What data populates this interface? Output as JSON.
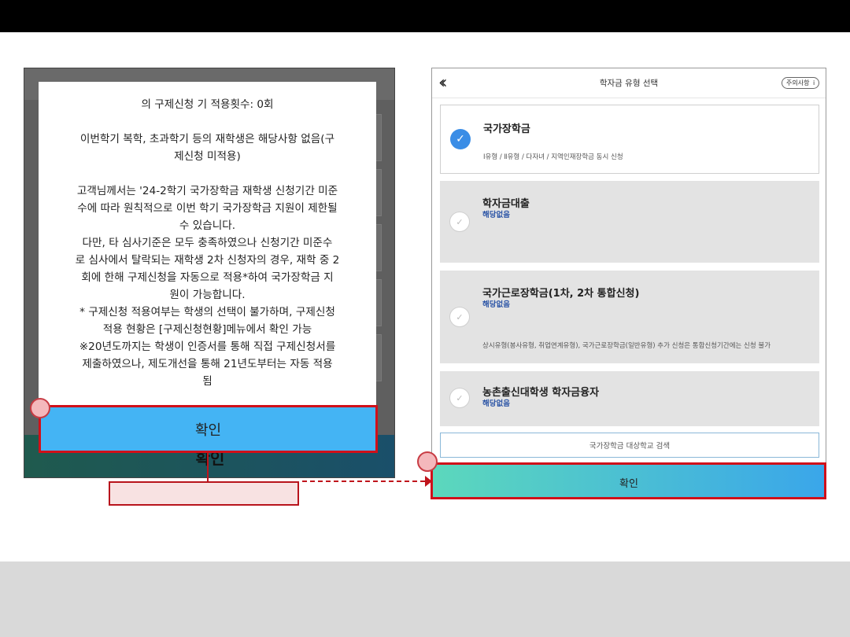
{
  "left_screen": {
    "background_confirm_label": "확인",
    "modal": {
      "lines": [
        "의 구제신청 기 적용횟수: 0회",
        "",
        "이번학기 복학, 초과학기 등의 재학생은 해당사항 없음(구",
        "제신청 미적용)",
        "",
        "고객님께서는 '24-2학기 국가장학금 재학생 신청기간 미준",
        "수에 따라 원칙적으로 이번 학기 국가장학금 지원이 제한될",
        "수 있습니다.",
        "다만, 타 심사기준은 모두 충족하였으나 신청기간 미준수",
        "로 심사에서 탈락되는 재학생 2차 신청자의 경우, 재학 중 2",
        "회에 한해 구제신청을 자동으로 적용*하여 국가장학금 지",
        "원이 가능합니다.",
        "* 구제신청 적용여부는 학생의 선택이 불가하며, 구제신청",
        "적용 현황은 [구제신청현황]메뉴에서 확인 가능",
        "※20년도까지는 학생이 인증서를 통해 직접 구제신청서를",
        "제출하였으나, 제도개선을 통해 21년도부터는 자동 적용",
        "됨"
      ],
      "confirm_label": "확인"
    }
  },
  "right_screen": {
    "header": {
      "back_icon": "double-chevron-left-icon",
      "title": "학자금 유형 선택",
      "notice_label": "주의사항",
      "notice_icon": "i"
    },
    "options": [
      {
        "title": "국가장학금",
        "subtitle": "",
        "desc": "Ⅰ유형 / Ⅱ유형 / 다자녀 / 지역인재장학금 동시 신청",
        "selected": true
      },
      {
        "title": "학자금대출",
        "subtitle": "해당없음",
        "desc": "",
        "selected": false
      },
      {
        "title": "국가근로장학금(1차, 2차 통합신청)",
        "subtitle": "해당없음",
        "desc": "상시유형(봉사유형, 취업연계유형), 국가근로장학금(일반유형) 추가 신청은 통합신청기간에는 신청 불가",
        "selected": false
      },
      {
        "title": "농촌출신대학생 학자금융자",
        "subtitle": "해당없음",
        "desc": "",
        "selected": false
      }
    ],
    "search_label": "국가장학금 대상학교 검색",
    "confirm_label": "확인"
  },
  "colors": {
    "highlight": "#d0101a",
    "modal_confirm": "#44b4f4",
    "check_on": "#3a8de6"
  }
}
